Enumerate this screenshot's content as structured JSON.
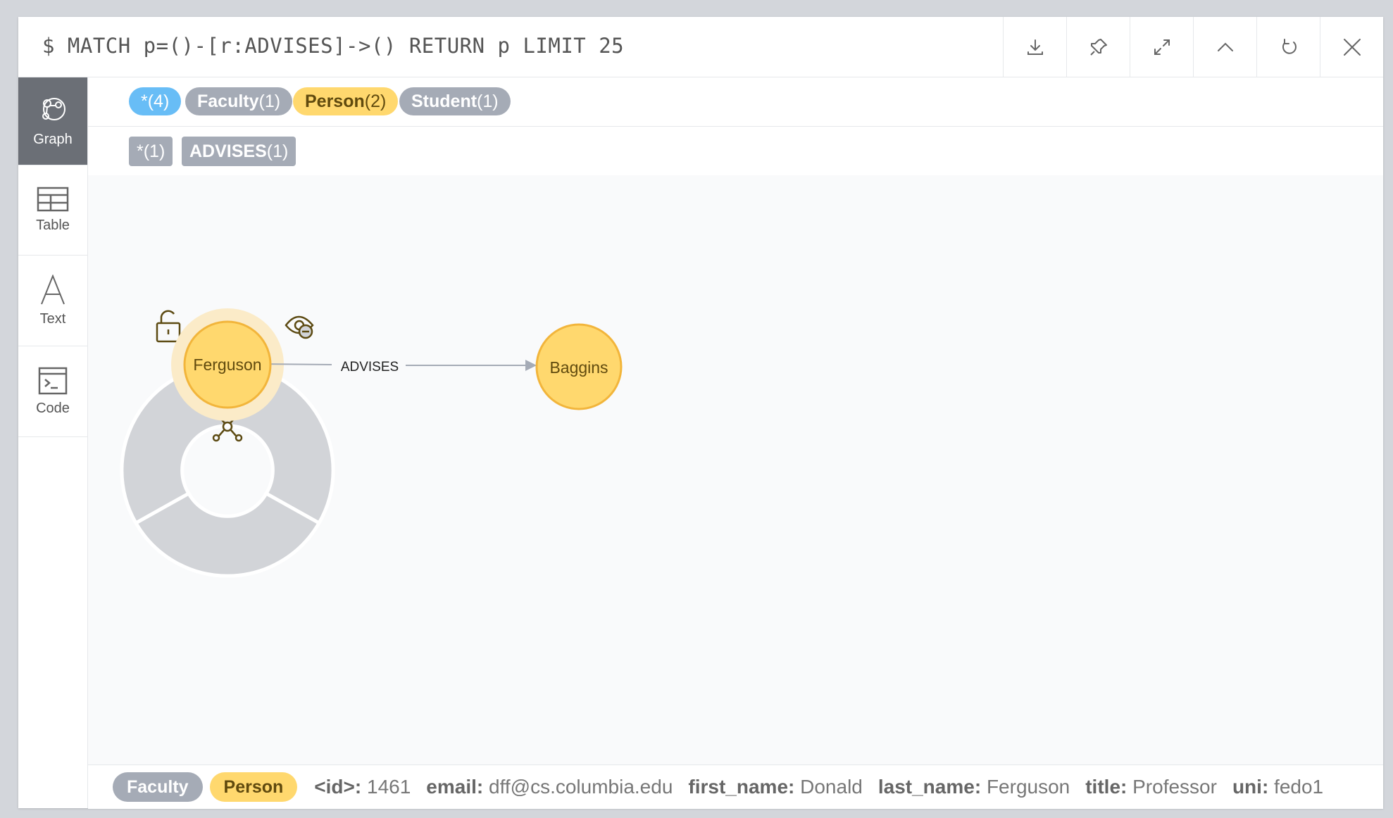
{
  "header": {
    "query": "$ MATCH p=()-[r:ADVISES]->() RETURN p LIMIT 25",
    "buttons": [
      "download-icon",
      "pin-icon",
      "expand-icon",
      "collapse-icon",
      "rerun-icon",
      "close-icon"
    ]
  },
  "sidebar": {
    "items": [
      {
        "label": "Graph",
        "icon": "graph-icon",
        "active": true
      },
      {
        "label": "Table",
        "icon": "table-icon",
        "active": false
      },
      {
        "label": "Text",
        "icon": "text-icon",
        "active": false
      },
      {
        "label": "Code",
        "icon": "code-icon",
        "active": false
      }
    ]
  },
  "node_labels": [
    {
      "name": "*",
      "count": "(4)",
      "color": "#68bdf6"
    },
    {
      "name": "Faculty",
      "count": "(1)",
      "color": "#a5abb6"
    },
    {
      "name": "Person",
      "count": "(2)",
      "color": "#ffd86e"
    },
    {
      "name": "Student",
      "count": "(1)",
      "color": "#a5abb6"
    }
  ],
  "rel_types": [
    {
      "name": "*",
      "count": "(1)"
    },
    {
      "name": "ADVISES",
      "count": "(1)"
    }
  ],
  "graph": {
    "nodes": [
      {
        "id": "ferguson",
        "caption": "Ferguson",
        "selected": true
      },
      {
        "id": "baggins",
        "caption": "Baggins",
        "selected": false
      }
    ],
    "relationship": {
      "type": "ADVISES",
      "from": "ferguson",
      "to": "baggins"
    },
    "ring_icons": [
      "unlock-icon",
      "hide-eye-icon",
      "expand-network-icon"
    ]
  },
  "footer": {
    "labels": [
      {
        "name": "Faculty",
        "color": "#a5abb6"
      },
      {
        "name": "Person",
        "color": "#ffd86e"
      }
    ],
    "properties": [
      {
        "key": "<id>:",
        "value": "1461"
      },
      {
        "key": "email:",
        "value": "dff@cs.columbia.edu"
      },
      {
        "key": "first_name:",
        "value": "Donald"
      },
      {
        "key": "last_name:",
        "value": "Ferguson"
      },
      {
        "key": "title:",
        "value": "Professor"
      },
      {
        "key": "uni:",
        "value": "fedo1"
      }
    ]
  },
  "colors": {
    "node_fill": "#ffd86e",
    "node_stroke": "#f2b53b",
    "ring": "#d2d4d8",
    "pill_grey": "#a5abb6",
    "pill_blue": "#68bdf6"
  }
}
